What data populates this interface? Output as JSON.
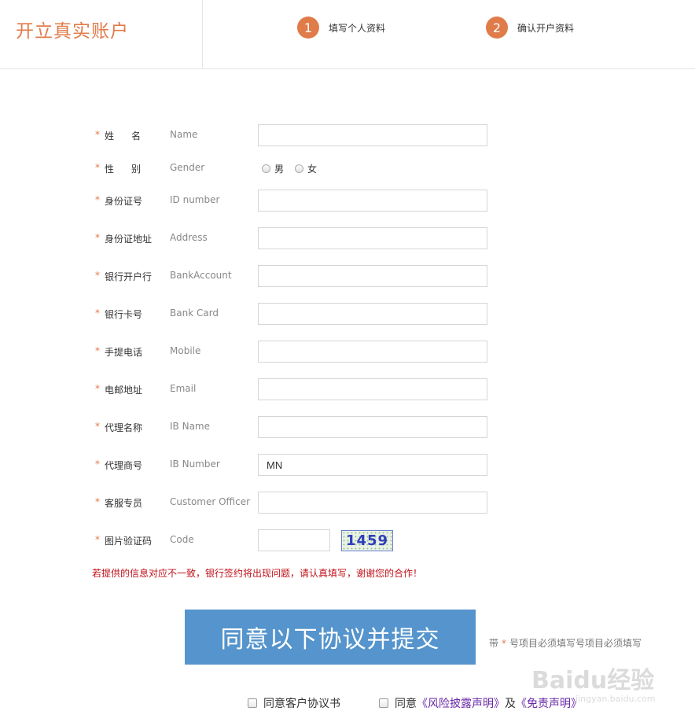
{
  "header": {
    "title": "开立真实账户",
    "steps": [
      {
        "num": "1",
        "label": "填写个人资料"
      },
      {
        "num": "2",
        "label": "确认开户资料"
      }
    ]
  },
  "form": {
    "required_mark": "*",
    "name": {
      "cn": "姓名",
      "en": "Name",
      "value": ""
    },
    "gender": {
      "cn": "性别",
      "en": "Gender",
      "options": [
        "男",
        "女"
      ]
    },
    "id_number": {
      "cn": "身份证号",
      "en": "ID number",
      "value": ""
    },
    "address": {
      "cn": "身份证地址",
      "en": "Address",
      "value": ""
    },
    "bank_account": {
      "cn": "银行开户行",
      "en": "BankAccount",
      "value": ""
    },
    "bank_card": {
      "cn": "银行卡号",
      "en": "Bank Card",
      "value": ""
    },
    "mobile": {
      "cn": "手提电话",
      "en": "Mobile",
      "value": ""
    },
    "email": {
      "cn": "电邮地址",
      "en": "Email",
      "value": ""
    },
    "ib_name": {
      "cn": "代理名称",
      "en": "IB Name",
      "value": ""
    },
    "ib_number": {
      "cn": "代理商号",
      "en": "IB Number",
      "value": "MN"
    },
    "customer_officer": {
      "cn": "客服专员",
      "en": "Customer Officer",
      "value": ""
    },
    "code": {
      "cn": "图片验证码",
      "en": "Code",
      "value": "",
      "captcha": "1459"
    }
  },
  "warning": "若提供的信息对应不一致，银行签约将出现问题，请认真填写，谢谢您的合作！",
  "submit": {
    "label": "同意以下协议并提交",
    "note_prefix": "带",
    "note_star": "*",
    "note_suffix": "号项目必须填写号项目必须填写"
  },
  "agreements": {
    "a1": "同意客户协议书",
    "a2_prefix": "同意",
    "a2_link1": "《风险披露声明》",
    "a2_mid": "及",
    "a2_link2": "《免责声明》"
  },
  "watermark": {
    "text": "Baidu经验",
    "sub": "jingyan.baidu.com"
  },
  "colors": {
    "accent": "#e07b4a",
    "button": "#5594cc",
    "warning": "#c0121a",
    "link": "#6a2aa8"
  }
}
